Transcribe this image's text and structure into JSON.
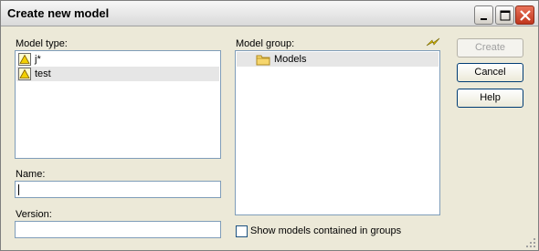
{
  "window": {
    "title": "Create new model"
  },
  "model_type": {
    "label": "Model type:",
    "items": [
      {
        "label": "j*",
        "icon": "warning-triangle-icon"
      },
      {
        "label": "test",
        "icon": "warning-triangle-icon"
      }
    ]
  },
  "model_group": {
    "label": "Model group:",
    "tree": [
      {
        "label": "Models",
        "icon": "folder-icon"
      }
    ],
    "refresh_icon": "lightning-icon"
  },
  "name": {
    "label": "Name:",
    "value": ""
  },
  "version": {
    "label": "Version:",
    "value": ""
  },
  "show_models": {
    "label": "Show models contained in groups",
    "checked": false
  },
  "buttons": {
    "create": "Create",
    "cancel": "Cancel",
    "help": "Help"
  },
  "colors": {
    "window_bg": "#ece9d8",
    "field_border": "#7f9db9",
    "button_border": "#003c74"
  }
}
